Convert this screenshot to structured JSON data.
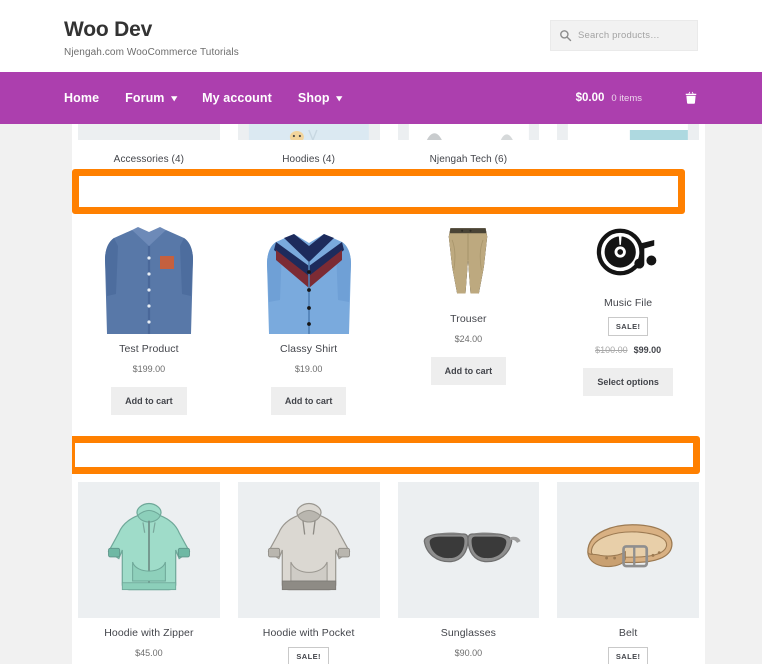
{
  "header": {
    "site_title": "Woo Dev",
    "site_description": "Njengah.com WooCommerce Tutorials",
    "search": {
      "icon": "search-icon",
      "placeholder": "Search products…",
      "value": ""
    }
  },
  "nav": {
    "items": [
      {
        "label": "Home",
        "has_dropdown": false
      },
      {
        "label": "Forum",
        "has_dropdown": true,
        "caret": "chevron-down-icon"
      },
      {
        "label": "My account",
        "has_dropdown": false
      },
      {
        "label": "Shop",
        "has_dropdown": true,
        "caret": "chevron-down-icon"
      }
    ],
    "cart": {
      "amount": "$0.00",
      "items_text": "0 items",
      "icon": "shopping-basket-icon"
    }
  },
  "categories": [
    {
      "label": "Accessories (4)"
    },
    {
      "label": "Hoodies (4)"
    },
    {
      "label": "Njengah Tech (6)"
    },
    {
      "label": ""
    }
  ],
  "highlight_boxes": [
    {
      "name": "top-highlight-box",
      "color": "#FF8000",
      "content": ""
    },
    {
      "name": "middle-highlight-box",
      "color": "#FF8000",
      "content": ""
    }
  ],
  "products_top": [
    {
      "title": "Test Product",
      "price": "$199.00",
      "on_sale": false,
      "sale_label": "",
      "regular_price": "",
      "button_label": "Add to cart",
      "image": "blue-denim-shirt",
      "image_bg": "white"
    },
    {
      "title": "Classy Shirt",
      "price": "$19.00",
      "on_sale": false,
      "sale_label": "",
      "regular_price": "",
      "button_label": "Add to cart",
      "image": "light-blue-chevron-shirt",
      "image_bg": "white"
    },
    {
      "title": "Trouser",
      "price": "$24.00",
      "on_sale": false,
      "sale_label": "",
      "regular_price": "",
      "button_label": "Add to cart",
      "image": "khaki-trousers",
      "image_bg": "white"
    },
    {
      "title": "Music File",
      "price": "$99.00",
      "on_sale": true,
      "sale_label": "SALE!",
      "regular_price": "$100.00",
      "button_label": "Select options",
      "image": "music-disc-note",
      "image_bg": "white"
    }
  ],
  "products_bottom": [
    {
      "title": "Hoodie with Zipper",
      "price": "$45.00",
      "on_sale": false,
      "sale_label": "",
      "regular_price": "",
      "image": "mint-zip-hoodie",
      "image_bg": "grey"
    },
    {
      "title": "Hoodie with Pocket",
      "price": "",
      "on_sale": true,
      "sale_label": "SALE!",
      "regular_price": "",
      "image": "grey-pocket-hoodie",
      "image_bg": "grey"
    },
    {
      "title": "Sunglasses",
      "price": "$90.00",
      "on_sale": false,
      "sale_label": "",
      "regular_price": "",
      "image": "grey-sunglasses",
      "image_bg": "grey"
    },
    {
      "title": "Belt",
      "price": "",
      "on_sale": true,
      "sale_label": "SALE!",
      "regular_price": "",
      "image": "tan-leather-belt",
      "image_bg": "grey"
    }
  ],
  "colors": {
    "nav_purple": "#AC3FAE",
    "highlight_orange": "#FF8000",
    "page_bg": "#F1F1F1",
    "content_bg": "#FFFFFF",
    "thumb_bg": "#ECEFF1"
  }
}
